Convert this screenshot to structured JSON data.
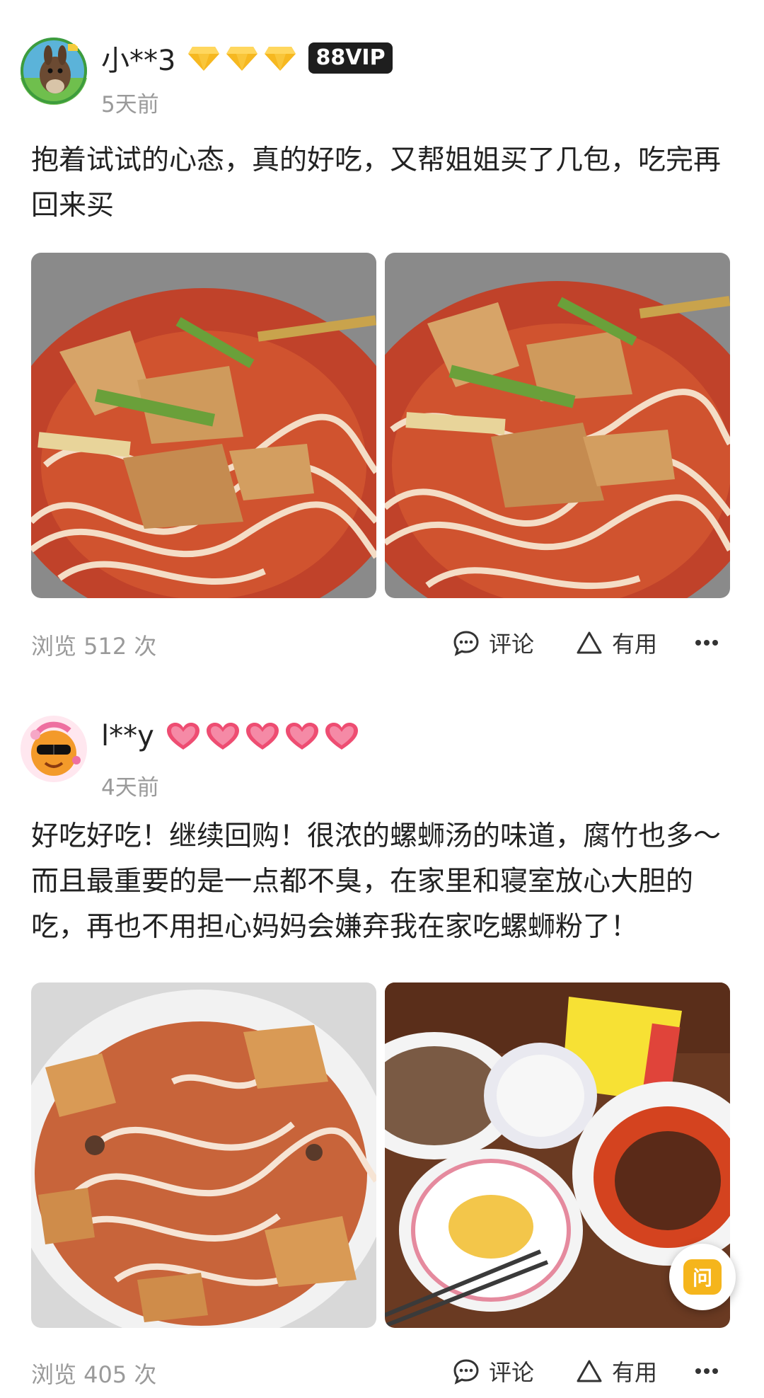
{
  "reviews": [
    {
      "username": "小**3",
      "vip_label": "88VIP",
      "badge_icon": "gold-diamond-icon",
      "badge_count": 3,
      "time_ago": "5天前",
      "text": "抱着试试的心态，真的好吃，又帮姐姐买了几包，吃完再回来买",
      "photos": [
        "luosifen-bowl-photo",
        "luosifen-bowl-closeup-photo"
      ],
      "views": "浏览 512 次",
      "comment_label": "评论",
      "useful_label": "有用"
    },
    {
      "username": "l**y",
      "badge_icon": "pink-heart-icon",
      "badge_count": 5,
      "time_ago": "4天前",
      "text": "好吃好吃！继续回购！很浓的螺蛳汤的味道，腐竹也多～而且最重要的是一点都不臭，在家里和寝室放心大胆的吃，再也不用担心妈妈会嫌弃我在家吃螺蛳粉了！",
      "photos": [
        "luosifen-plate-photo",
        "dinner-table-photo"
      ],
      "views": "浏览 405 次",
      "comment_label": "评论",
      "useful_label": "有用"
    }
  ],
  "ask_button": {
    "label": "问",
    "icon": "ask-question-icon"
  },
  "colors": {
    "text_primary": "#222222",
    "text_secondary": "#9a9a9a",
    "vip_badge_bg": "#1e1e1e",
    "ask_button_accent": "#f5b51c",
    "gold_badge": "#f6b820",
    "heart_badge": "#ee4d72"
  }
}
